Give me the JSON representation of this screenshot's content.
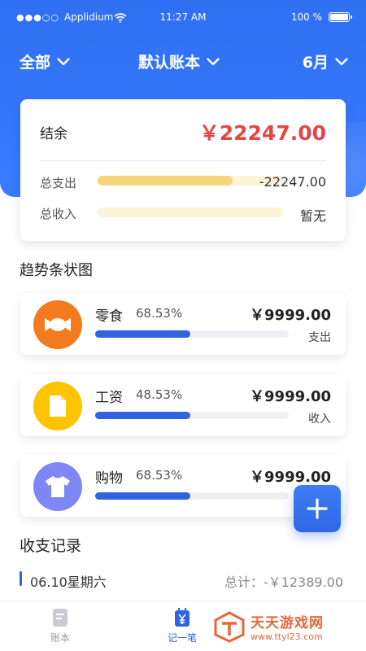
{
  "status_bar": {
    "carrier": "Applidium",
    "signal_dots": "●●●○○",
    "time": "11:27 AM",
    "battery": "100 %"
  },
  "nav": {
    "filter_label": "全部",
    "account_label": "默认账本",
    "month_label": "6月"
  },
  "summary": {
    "balance_label": "结余",
    "balance_value": "￥22247.00",
    "expense_label": "总支出",
    "expense_value": "-22247.00",
    "expense_fill": 0.73,
    "income_label": "总收入",
    "income_value": "暂无",
    "income_fill": 0
  },
  "trend": {
    "title": "趋势条状图",
    "items": [
      {
        "name": "零食",
        "percent": "68.53%",
        "amount": "￥9999.00",
        "type": "支出",
        "fill": 0.49,
        "icon": "candy-icon",
        "color": "#f47a1f"
      },
      {
        "name": "工资",
        "percent": "48.53%",
        "amount": "￥9999.00",
        "type": "收入",
        "fill": 0.49,
        "icon": "document-icon",
        "color": "#ffc400"
      },
      {
        "name": "购物",
        "percent": "68.53%",
        "amount": "￥9999.00",
        "type": "",
        "fill": 0.49,
        "icon": "shirt-icon",
        "color": "#7f86f5"
      }
    ]
  },
  "records": {
    "title": "收支记录",
    "date": "06.10星期六",
    "total": "总计：-￥12389.00"
  },
  "tabs": {
    "ledger_label": "账本",
    "record_label": "记一笔"
  },
  "watermark": {
    "name": "天天游戏网",
    "url": "www.ttyl23.com"
  }
}
